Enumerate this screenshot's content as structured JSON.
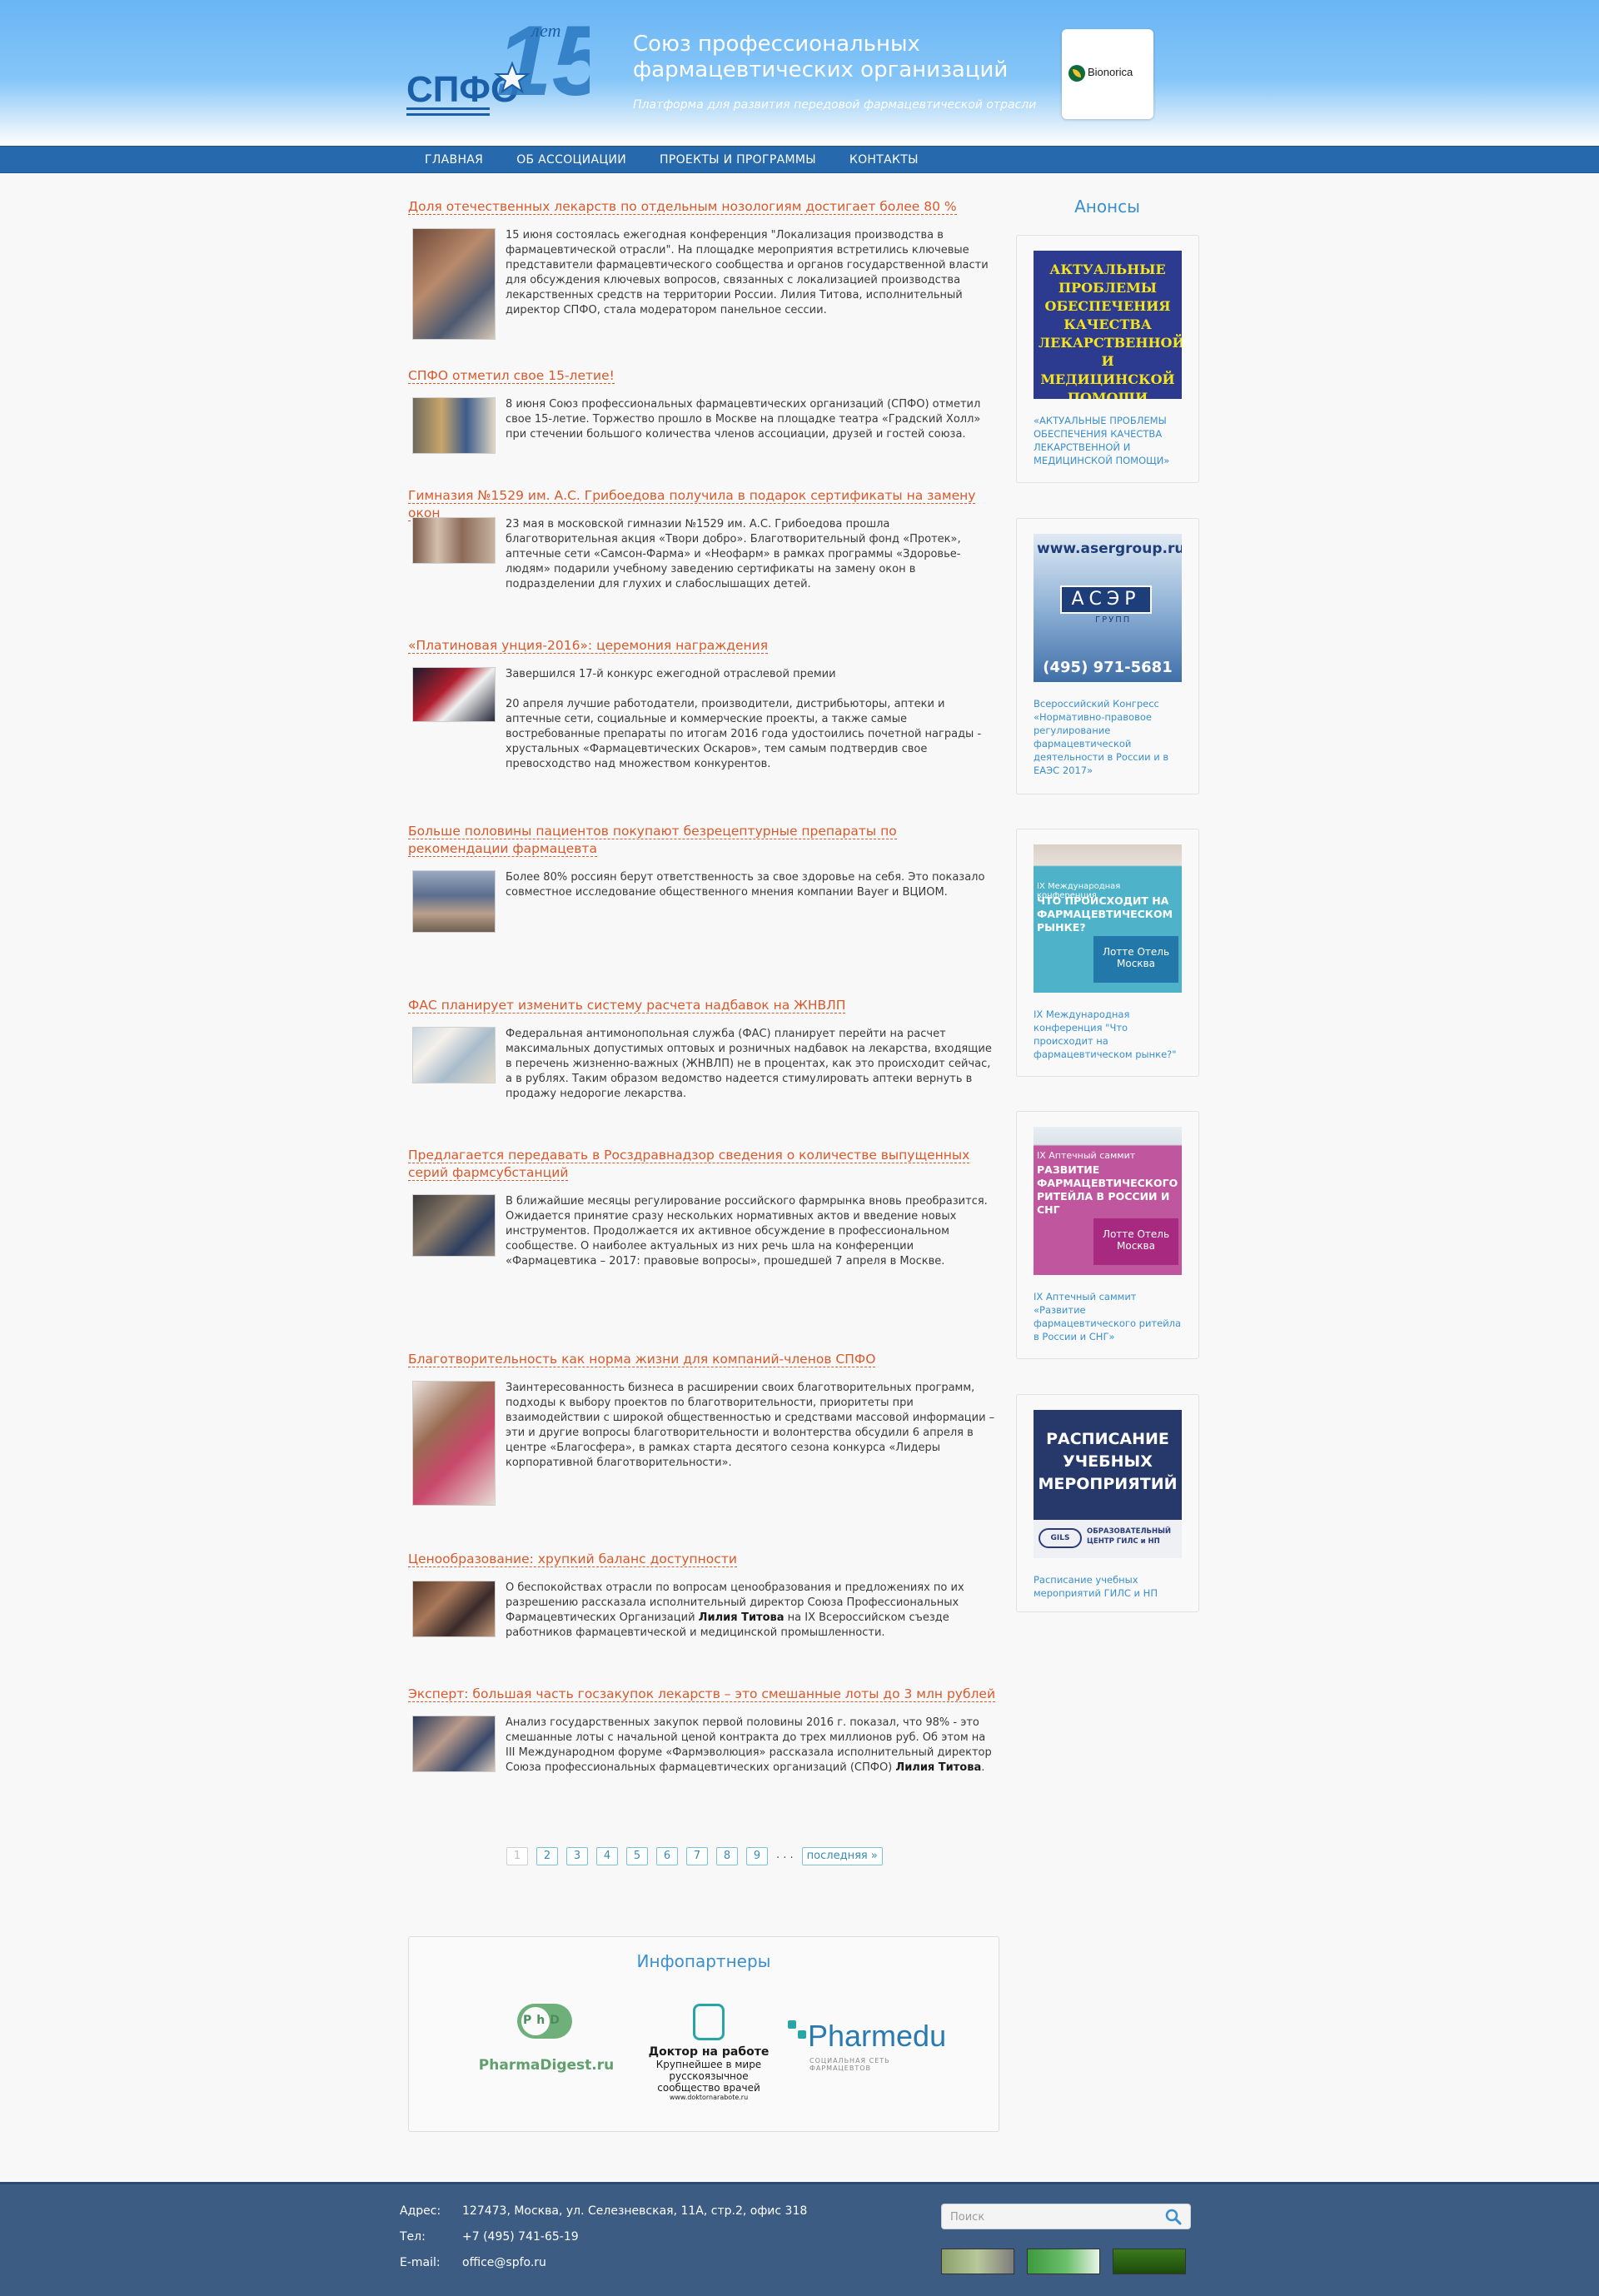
{
  "header": {
    "title": "Союз профессиональных фармацевтических организаций",
    "slogan": "Платформа для развития передовой фармацевтической отрасли",
    "logo_text": "СПФО",
    "logo_years": "15",
    "logo_years_word": "лет",
    "partner": "Bionorica"
  },
  "nav": [
    "ГЛАВНАЯ",
    "ОБ АССОЦИАЦИИ",
    "ПРОЕКТЫ И ПРОГРАММЫ",
    "КОНТАКТЫ"
  ],
  "articles": [
    {
      "title": "Доля отечественных лекарств по отдельным нозологиям достигает более 80 %",
      "paragraphs": [
        "15 июня состоялась ежегодная  конференция \"Локализация производства в фармацевтической отрасли\". На площадке мероприятия встретились ключевые представители фармацевтического сообщества и органов государственной власти для обсуждения ключевых вопросов, связанных с локализацией производства лекарственных средств на территории России. Лилия Титова, исполнительный директор СПФО, стала модератором панельное сессии."
      ]
    },
    {
      "title": "СПФО отметил свое 15-летие!",
      "paragraphs": [
        "8 июня Союз профессиональных фармацевтических организаций (СПФО) отметил свое 15-летие. Торжество прошло в Москве на площадке театра «Градский Холл» при стечении большого количества членов ассоциации, друзей и гостей союза."
      ]
    },
    {
      "title": "Гимназия №1529 им. А.С. Грибоедова получила в подарок сертификаты на замену окон",
      "paragraphs": [
        "23 мая в московской гимназии №1529 им. А.С. Грибоедова прошла благотворительная акция «Твори добро». Благотворительный фонд «Протек», аптечные сети «Самсон-Фарма» и «Неофарм» в рамках программы «Здоровье-людям» подарили учебному заведению сертификаты на замену окон в подразделении для глухих и слабослышащих детей."
      ]
    },
    {
      "title": "«Платиновая унция-2016»: церемония награждения",
      "paragraphs": [
        "Завершился 17-й конкурс ежегодной отраслевой премии",
        "20 апреля лучшие работодатели, производители, дистрибьюторы, аптеки и аптечные сети,  социальные и коммерческие проекты, а также  самые востребованные препараты по итогам 2016 года удостоились почетной награды  - хрустальных «Фармацевтических Оскаров», тем самым подтвердив свое превосходство над множеством конкурентов."
      ]
    },
    {
      "title": "Больше половины пациентов покупают безрецептурные препараты по рекомендации фармацевта",
      "paragraphs": [
        "Более 80% россиян берут ответственность за свое здоровье на себя. Это показало совместное исследование общественного мнения компании Bayer и ВЦИОМ."
      ]
    },
    {
      "title": "ФАС планирует изменить систему расчета надбавок на ЖНВЛП",
      "paragraphs": [
        "Федеральная антимонопольная служба (ФАС) планирует перейти на расчет максимальных допустимых оптовых и розничных надбавок на лекарства, входящие в перечень жизненно-важных (ЖНВЛП) не в процентах, как это происходит сейчас, а в рублях. Таким образом ведомство надеется стимулировать аптеки вернуть в продажу недорогие лекарства."
      ]
    },
    {
      "title": "Предлагается передавать в Росздравнадзор сведения о количестве выпущенных серий фармсубстанций",
      "paragraphs": [
        "В ближайшие месяцы регулирование российского фармрынка вновь преобразится. Ожидается принятие сразу нескольких нормативных актов и введение новых инструментов. Продолжается их активное обсуждение в профессиональном сообществе. О наиболее актуальных из них речь шла на конференции «Фармацевтика – 2017: правовые вопросы», прошедшей 7 апреля в Москве."
      ]
    },
    {
      "title": "Благотворительность как норма жизни для компаний-членов СПФО",
      "paragraphs": [
        "Заинтересованность бизнеса в расширении своих благотворительных программ, подходы к выбору проектов по благотворительности, приоритеты при взаимодействии с широкой общественностью и средствами массовой информации – эти и другие вопросы благотворительности и волонтерства обсудили 6 апреля в центре «Благосфера», в рамках старта десятого сезона конкурса «Лидеры корпоративной благотворительности»."
      ]
    },
    {
      "title": "Ценообразование: хрупкий баланс доступности",
      "paragraphs": [
        "О беспокойствах отрасли по вопросам ценообразования и предложениях по их разрешению рассказала исполнительный директор Союза Профессиональных Фармацевтических Организаций"
      ],
      "bold": "Лилия Титова",
      "after": "  на IX Всероссийском съезде работников фармацевтической и медицинской промышленности."
    },
    {
      "title": "Эксперт: большая часть госзакупок лекарств – это смешанные лоты до 3 млн рублей",
      "paragraphs": [
        "Анализ государственных закупок первой половины 2016 г. показал, что 98% - это смешанные лоты с начальной ценой контракта до трех миллионов руб. Об этом на III Международном форуме «Фармэволюция» рассказала исполнительный директор Союза профессиональных фармацевтических организаций (СПФО)"
      ],
      "bold": "Лилия Титова",
      "after": "."
    }
  ],
  "pager": {
    "pages": [
      "1",
      "2",
      "3",
      "4",
      "5",
      "6",
      "7",
      "8",
      "9"
    ],
    "dots": ". . .",
    "last": "последняя »"
  },
  "infopartners": {
    "title": "Инфопартнеры",
    "pharmadigest": "PharmaDigest.ru",
    "pharmadigest_badge": "PhD",
    "doktor_title": "Доктор на работе",
    "doktor_sub": "Крупнейшее в мире русскоязычное сообщество врачей",
    "doktor_url": "www.doktornarabote.ru",
    "pharmedu": "Pharmedu",
    "pharmedu_sub": "СОЦИАЛЬНАЯ СЕТЬ ФАРМАЦЕВТОВ"
  },
  "sidebar": {
    "title": "Анонсы",
    "banners": [
      {
        "text": "АКТУАЛЬНЫЕ ПРОБЛЕМЫ ОБЕСПЕЧЕНИЯ КАЧЕСТВА ЛЕКАРСТВЕННОЙ И МЕДИЦИНСКОЙ ПОМОЩИ",
        "caption": "«АКТУАЛЬНЫЕ ПРОБЛЕМЫ ОБЕСПЕЧЕНИЯ КАЧЕСТВА ЛЕКАРСТВЕННОЙ И МЕДИЦИНСКОЙ ПОМОЩИ»"
      },
      {
        "url": "www.asergroup.ru",
        "brand": "АСЭР",
        "brand_sub": "ГРУПП",
        "phone": "(495) 971-5681",
        "caption": "Всероссийский Конгресс «Нормативно-правовое регулирование фармацевтической деятельности в России и в ЕАЭС 2017»"
      },
      {
        "top": "IX Международная конференция",
        "main": "ЧТО ПРОИСХОДИТ НА ФАРМАЦЕВТИЧЕСКОМ РЫНКЕ?",
        "place": "Лотте Отель Москва",
        "caption": "IX Международная конференция \"Что происходит на фармацевтическом рынке?\""
      },
      {
        "top": "IX Аптечный саммит",
        "main": "РАЗВИТИЕ ФАРМАЦЕВТИЧЕСКОГО РИТЕЙЛА В РОССИИ И СНГ",
        "place": "Лотте Отель Москва",
        "caption": "IX Аптечный саммит «Развитие фармацевтического ритейла в России и СНГ»"
      },
      {
        "main": "РАСПИСАНИЕ УЧЕБНЫХ МЕРОПРИЯТИЙ",
        "org": "ОБРАЗОВАТЕЛЬНЫЙ ЦЕНТР ГИЛС и НП",
        "org_logo": "GILS",
        "caption": "Расписание учебных мероприятий ГИЛС и НП"
      }
    ]
  },
  "footer": {
    "address_label": "Адрес:",
    "address": "127473, Москва, ул. Селезневская, 11А, стр.2, офис 318",
    "phone_label": "Тел:",
    "phone": "+7 (495) 741-65-19",
    "email_label": "E-mail:",
    "email": "office@spfo.ru",
    "search_placeholder": "Поиск",
    "counters": [
      "rating",
      "liveinternet"
    ]
  },
  "colors": {
    "header_top": "#69b5f5",
    "nav": "#266aad",
    "link": "#d85a2c",
    "accent": "#3a8fcf",
    "footer": "#3c5c84"
  }
}
